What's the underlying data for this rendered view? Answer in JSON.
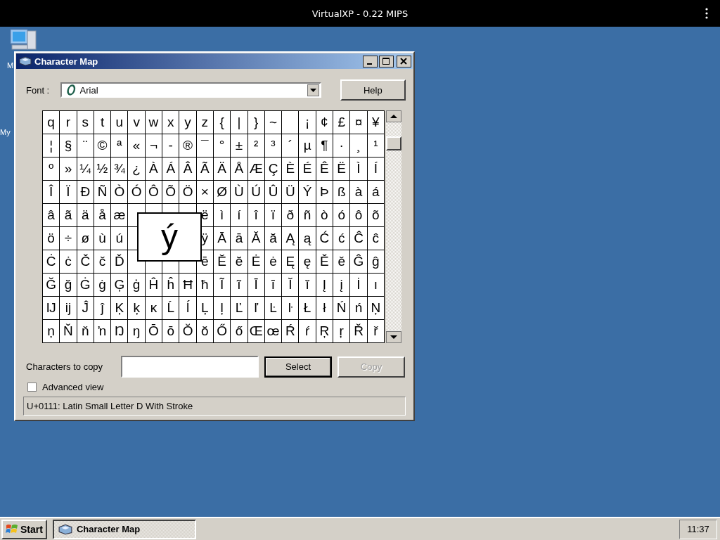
{
  "top_bar": {
    "title": "VirtualXP - 0.22 MIPS"
  },
  "desktop_icons": [
    {
      "kind": "computer",
      "label": "M"
    },
    {
      "kind": "label_only",
      "label": "My"
    }
  ],
  "window": {
    "title": "Character Map",
    "font_label": "Font :",
    "font_value": "Arial",
    "help": "Help",
    "grid": [
      [
        "q",
        "r",
        "s",
        "t",
        "u",
        "v",
        "w",
        "x",
        "y",
        "z",
        "{",
        "|",
        "}",
        "~",
        {
          "kind": "empty"
        },
        "¡",
        "¢",
        "£",
        "¤",
        "¥"
      ],
      [
        "¦",
        "§",
        "¨",
        "©",
        "ª",
        "«",
        "¬",
        "-",
        "®",
        "¯",
        "°",
        "±",
        "²",
        "³",
        "´",
        "µ",
        "¶",
        "·",
        "¸",
        "¹"
      ],
      [
        "º",
        "»",
        "¼",
        "½",
        "¾",
        "¿",
        "À",
        "Á",
        "Â",
        "Ã",
        "Ä",
        "Å",
        "Æ",
        "Ç",
        "È",
        "É",
        "Ê",
        "Ë",
        "Ì",
        "Í"
      ],
      [
        "Î",
        "Ï",
        "Ð",
        "Ñ",
        "Ò",
        "Ó",
        "Ô",
        "Õ",
        "Ö",
        "×",
        "Ø",
        "Ù",
        "Ú",
        "Û",
        "Ü",
        "Ý",
        "Þ",
        "ß",
        "à",
        "á"
      ],
      [
        "â",
        "ã",
        "ä",
        "å",
        "æ",
        {
          "kind": "empty"
        },
        {
          "kind": "empty"
        },
        {
          "kind": "empty"
        },
        {
          "kind": "empty"
        },
        "ë",
        "ì",
        "í",
        "î",
        "ï",
        "ð",
        "ñ",
        "ò",
        "ó",
        "ô",
        "õ"
      ],
      [
        "ö",
        "÷",
        "ø",
        "ù",
        "ú",
        {
          "kind": "empty"
        },
        {
          "kind": "hidden"
        },
        {
          "kind": "hidden"
        },
        {
          "kind": "hidden"
        },
        "ÿ",
        "Ā",
        "ā",
        "Ă",
        "ă",
        "Ą",
        "ą",
        "Ć",
        "ć",
        "Ĉ",
        "ĉ"
      ],
      [
        "Ċ",
        "ċ",
        "Č",
        "č",
        "Ď",
        {
          "kind": "empty"
        },
        {
          "kind": "empty"
        },
        {
          "kind": "empty"
        },
        {
          "kind": "empty"
        },
        "ē",
        "Ĕ",
        "ĕ",
        "Ė",
        "ė",
        "Ę",
        "ę",
        "Ě",
        "ě",
        "Ĝ",
        "ĝ"
      ],
      [
        "Ğ",
        "ğ",
        "Ġ",
        "ġ",
        "Ģ",
        "ģ",
        "Ĥ",
        "ĥ",
        "Ħ",
        "ħ",
        "Ĩ",
        "ĩ",
        "Ī",
        "ī",
        "Ĭ",
        "ĭ",
        "Į",
        "į",
        "İ",
        "ı"
      ],
      [
        "Ĳ",
        "ĳ",
        "Ĵ",
        "ĵ",
        "Ķ",
        "ķ",
        "ĸ",
        "Ĺ",
        "ĺ",
        "Ļ",
        "ļ",
        "Ľ",
        "ľ",
        "Ŀ",
        "ŀ",
        "Ł",
        "ł",
        "Ń",
        "ń",
        "Ņ"
      ],
      [
        "ņ",
        "Ň",
        "ň",
        "ŉ",
        "Ŋ",
        "ŋ",
        "Ō",
        "ō",
        "Ŏ",
        "ŏ",
        "Ő",
        "ő",
        "Œ",
        "œ",
        "Ŕ",
        "ŕ",
        "Ŗ",
        "ŗ",
        "Ř",
        "ř"
      ]
    ],
    "magnified": "ý",
    "copy_label": "Characters to copy",
    "select": "Select",
    "copy": {
      "label": "Copy",
      "disabled": true
    },
    "advanced_view": {
      "label": "Advanced view",
      "checked": false
    },
    "status": "U+0111: Latin Small Letter D With Stroke"
  },
  "taskbar": {
    "start": "Start",
    "tasks": [
      {
        "label": "Character Map",
        "selected": true
      }
    ],
    "clock": "11:37"
  }
}
